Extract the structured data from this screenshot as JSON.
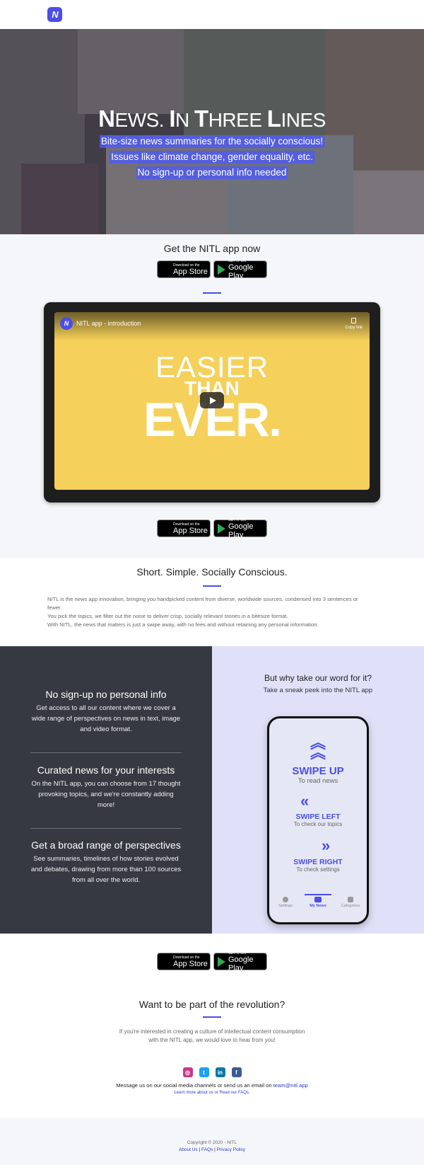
{
  "header": {
    "logo_text": "N"
  },
  "hero": {
    "title_parts": [
      {
        "cap": "N",
        "rest": "EWS. "
      },
      {
        "cap": "I",
        "rest": "N "
      },
      {
        "cap": "T",
        "rest": "HREE "
      },
      {
        "cap": "L",
        "rest": "INES"
      }
    ],
    "lines": [
      "Bite-size news summaries for the socially conscious!",
      "Issues like climate change, gender equality, etc.",
      "No sign-up or personal info needed"
    ]
  },
  "get_app": {
    "title": "Get the NITL app now",
    "app_store": {
      "small": "Download on the",
      "big": "App Store"
    },
    "google_play": {
      "small": "GET IT ON",
      "big": "Google Play"
    }
  },
  "video": {
    "channel_logo": "N",
    "title": "NITL app - introduction",
    "copy_link": "Copy link",
    "easier": "EASIER",
    "than": "THAN",
    "ever": "EVER."
  },
  "about": {
    "title": "Short. Simple. Socially Conscious.",
    "lines": [
      "NITL is the news app innovation, bringing you handpicked content from diverse, worldwide sources, condensed into 3 sentences or fewer.",
      "You pick the topics, we filter out the noise to deliver crisp, socially relevant stories in a bitesize format.",
      "With NITL, the news that matters is just a swipe away, with no fees and without retaining any personal information."
    ]
  },
  "features": [
    {
      "title": "No sign-up no personal info",
      "text": "Get access to all our content where we cover a wide range of perspectives on news in text, image and video format."
    },
    {
      "title": "Curated news for your interests",
      "text": "On the NITL app, you can choose from 17 thought provoking topics, and we're constantly adding more!"
    },
    {
      "title": "Get a broad range of perspectives",
      "text": "See summaries, timelines of how stories evolved and debates, drawing from more than 100 sources from all over the world."
    }
  ],
  "peek": {
    "title": "But why take our word for it?",
    "subtitle": "Take a sneak peek into the NITL app",
    "swipe_up": {
      "big": "SWIPE UP",
      "small": "To read news"
    },
    "swipe_left": {
      "big": "SWIPE LEFT",
      "small": "To check our topics"
    },
    "swipe_right": {
      "big": "SWIPE RIGHT",
      "small": "To check settings"
    },
    "tabs": [
      "Settings",
      "My News",
      "Categories"
    ]
  },
  "join": {
    "title": "Want to be part of the revolution?",
    "desc_line1": "If you're interested in creating a culture of intellectual content consumption",
    "desc_line2": "with the NITL app, we would love to hear from you!",
    "message": "Message us on our social media channels or send us an email on ",
    "email": "team@nitl.app",
    "learn_prefix": "Learn more ",
    "about_link": "about us",
    "learn_mid": " or ",
    "faq_link": "Read our FAQs."
  },
  "footer": {
    "copyright": "Copyright © 2020 - NITL",
    "about": "About Us",
    "faqs": "FAQs",
    "privacy": "Privacy Policy",
    "sep": " | "
  },
  "colors": {
    "accent": "#4a4fe6",
    "dark": "#363941",
    "lavender": "#e0e1f9",
    "video_yellow": "#f5d05a"
  }
}
